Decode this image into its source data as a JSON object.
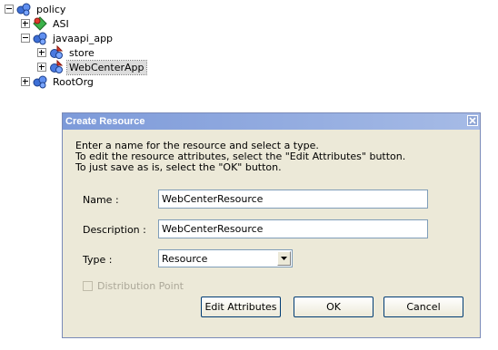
{
  "tree": {
    "nodes": [
      {
        "label": "policy",
        "expander": "minus",
        "icon": "policy-folder-icon"
      },
      {
        "label": "ASI",
        "expander": "plus",
        "icon": "application-icon"
      },
      {
        "label": "javaapi_app",
        "expander": "minus",
        "icon": "policy-folder-icon"
      },
      {
        "label": "store",
        "expander": "plus",
        "icon": "resource-icon"
      },
      {
        "label": "WebCenterApp",
        "expander": "plus",
        "icon": "resource-icon",
        "selected": true
      },
      {
        "label": "RootOrg",
        "expander": "plus",
        "icon": "policy-folder-icon"
      }
    ]
  },
  "dialog": {
    "title": "Create Resource",
    "intro_lines": [
      "Enter a name for the resource and select a type.",
      "To edit the resource attributes, select the \"Edit Attributes\" button.",
      "To just save as is, select the \"OK\" button."
    ],
    "name_label": "Name :",
    "name_value": "WebCenterResource",
    "description_label": "Description :",
    "description_value": "WebCenterResource",
    "type_label": "Type :",
    "type_value": "Resource",
    "distribution_label": "Distribution Point",
    "distribution_checked": false,
    "edit_attributes_label": "Edit Attributes",
    "ok_label": "OK",
    "cancel_label": "Cancel"
  },
  "colors": {
    "titlebar": "#7d9ad9",
    "dialog_bg": "#ece9d8",
    "input_border": "#7f9db9"
  }
}
